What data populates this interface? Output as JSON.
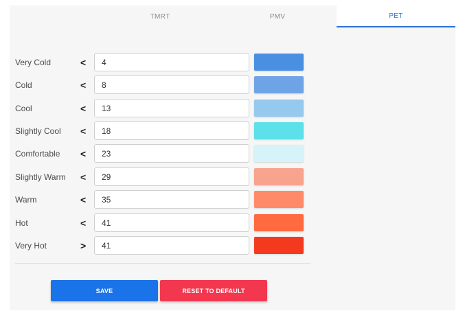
{
  "tabs": [
    {
      "label": "TMRT",
      "active": false
    },
    {
      "label": "PMV",
      "active": false
    },
    {
      "label": "PET",
      "active": true
    }
  ],
  "rows": [
    {
      "label": "Very Cold",
      "operator": "<",
      "value": "4",
      "color": "#4A90E2"
    },
    {
      "label": "Cold",
      "operator": "<",
      "value": "8",
      "color": "#6FA3E8"
    },
    {
      "label": "Cool",
      "operator": "<",
      "value": "13",
      "color": "#95C9EE"
    },
    {
      "label": "Slightly Cool",
      "operator": "<",
      "value": "18",
      "color": "#5CE0EA"
    },
    {
      "label": "Comfortable",
      "operator": "<",
      "value": "23",
      "color": "#D6F3FA"
    },
    {
      "label": "Slightly Warm",
      "operator": "<",
      "value": "29",
      "color": "#F8A38E"
    },
    {
      "label": "Warm",
      "operator": "<",
      "value": "35",
      "color": "#FF8A6A"
    },
    {
      "label": "Hot",
      "operator": "<",
      "value": "41",
      "color": "#FF6A40"
    },
    {
      "label": "Very Hot",
      "operator": ">",
      "value": "41",
      "color": "#F43A1E"
    }
  ],
  "buttons": {
    "save_label": "SAVE",
    "save_color": "#1A73E8",
    "reset_label": "RESET TO DEFAULT",
    "reset_color": "#F2374F"
  }
}
